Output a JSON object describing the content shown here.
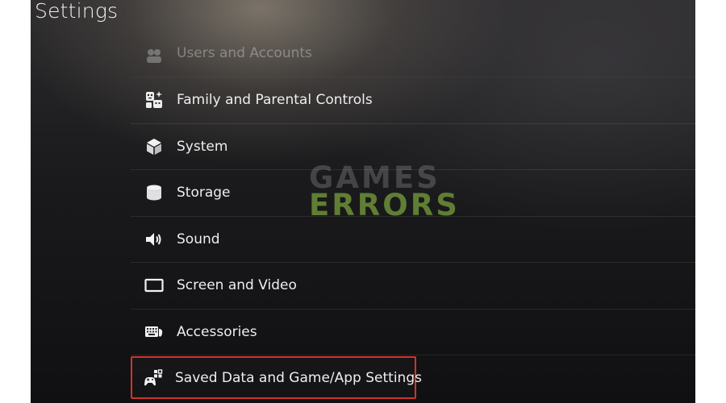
{
  "window": {
    "title": "Settings"
  },
  "menu": {
    "items": [
      {
        "label": "Users and Accounts",
        "icon": "users-icon",
        "state": "partially-visible"
      },
      {
        "label": "Family and Parental Controls",
        "icon": "family-icon"
      },
      {
        "label": "System",
        "icon": "cube-icon"
      },
      {
        "label": "Storage",
        "icon": "storage-icon"
      },
      {
        "label": "Sound",
        "icon": "speaker-icon"
      },
      {
        "label": "Screen and Video",
        "icon": "screen-icon"
      },
      {
        "label": "Accessories",
        "icon": "keyboard-icon"
      },
      {
        "label": "Saved Data and Game/App Settings",
        "icon": "saved-data-icon",
        "state": "selected"
      }
    ]
  },
  "watermark": {
    "line1": "GAMES",
    "line2": "ERRORS"
  },
  "colors": {
    "highlight_border": "#d0342c",
    "watermark_green": "#78a03c"
  }
}
